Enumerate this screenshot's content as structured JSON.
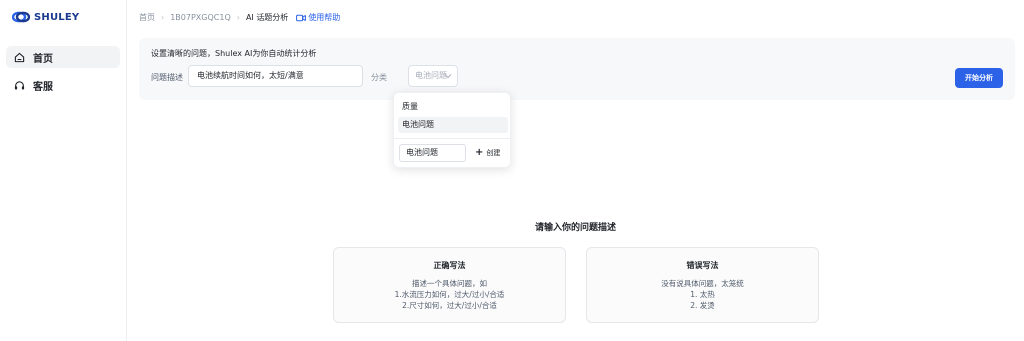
{
  "brand": {
    "name": "SHULEY",
    "color": "#1a3a8f",
    "accent": "#2b62e8"
  },
  "sidebar": {
    "items": [
      {
        "label": "首页",
        "icon": "home-icon",
        "active": true
      },
      {
        "label": "客服",
        "icon": "headset-icon",
        "active": false
      }
    ]
  },
  "breadcrumb": {
    "items": [
      "首页",
      "1B07PXGQC1Q",
      "AI 话题分析"
    ],
    "help": "使用帮助",
    "help_icon": "video-icon"
  },
  "query": {
    "hint": "设置清晰的问题，Shulex AI为你自动统计分析",
    "desc_label": "问题描述",
    "desc_value": "电池续航时间如何，太短/满意",
    "category_label": "分类",
    "category_value": "电池问题",
    "start_button": "开始分析"
  },
  "dropdown": {
    "options": [
      "质量",
      "电池问题"
    ],
    "highlighted": "电池问题",
    "new_input_value": "电池问题",
    "create_label": "创建"
  },
  "empty_state": {
    "title": "请输入你的问题描述",
    "correct": {
      "title": "正确写法",
      "lines": [
        "描述一个具体问题，如",
        "1.水流压力如何，过大/过小/合适",
        "2.尺寸如何，过大/过小/合适"
      ]
    },
    "wrong": {
      "title": "错误写法",
      "lines": [
        "没有说具体问题，太笼统",
        "1. 太热",
        "2. 发烫"
      ]
    }
  }
}
